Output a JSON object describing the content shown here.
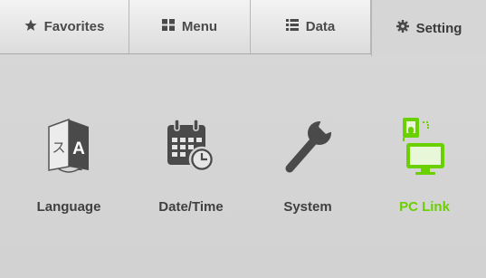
{
  "tabs": [
    {
      "label": "Favorites",
      "icon": "star-icon"
    },
    {
      "label": "Menu",
      "icon": "grid-icon"
    },
    {
      "label": "Data",
      "icon": "list-icon"
    },
    {
      "label": "Setting",
      "icon": "gear-icon"
    }
  ],
  "active_tab": "Setting",
  "settings": [
    {
      "label": "Language",
      "icon": "language-icon"
    },
    {
      "label": "Date/Time",
      "icon": "calendar-clock-icon"
    },
    {
      "label": "System",
      "icon": "wrench-icon"
    },
    {
      "label": "PC Link",
      "icon": "pc-link-icon"
    }
  ],
  "colors": {
    "accent": "#6ad000",
    "text": "#404040",
    "icon": "#4a4a4a",
    "background": "#d5d5d5"
  }
}
